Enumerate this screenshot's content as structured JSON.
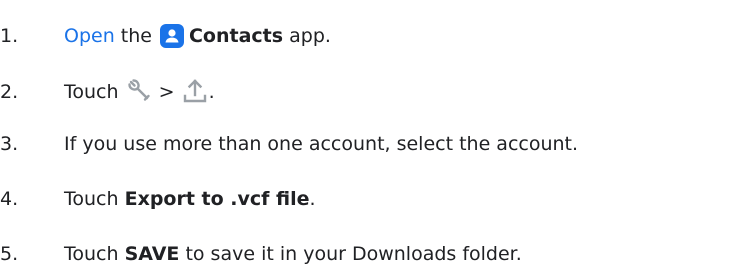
{
  "colors": {
    "text": "#202124",
    "link": "#1a73e8",
    "contacts_icon_bg": "#1a73e8",
    "icon_gray": "#9aa0a6"
  },
  "steps": [
    {
      "number": "1.",
      "link_text": "Open",
      "pre_icon": "the",
      "icon": "contacts-app-icon",
      "bold": "Contacts",
      "after": "app."
    },
    {
      "number": "2.",
      "text": "Touch",
      "icon1": "wrench-icon",
      "separator": ">",
      "icon2": "upload-icon",
      "after": "."
    },
    {
      "number": "3.",
      "text": "If you use more than one account, select the account."
    },
    {
      "number": "4.",
      "text": "Touch",
      "bold": "Export to .vcf file",
      "after": "."
    },
    {
      "number": "5.",
      "text": "Touch",
      "bold": "SAVE",
      "after": "to save it in your Downloads folder."
    }
  ]
}
